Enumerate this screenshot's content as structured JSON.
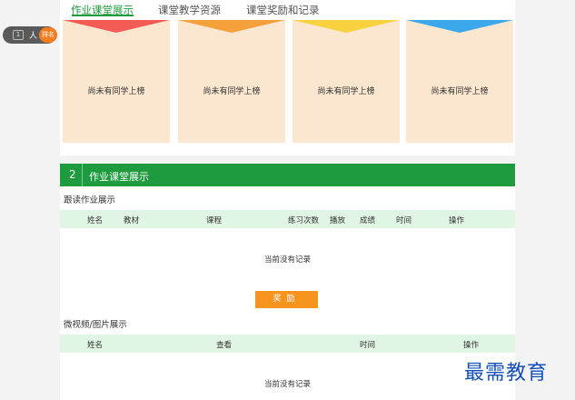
{
  "tabs": [
    {
      "label": "作业课堂展示",
      "active": true
    },
    {
      "label": "课堂教学资源",
      "active": false
    },
    {
      "label": "课堂奖励和记录",
      "active": false
    }
  ],
  "counter": {
    "value": "1",
    "unit": "人",
    "rank_label": "排名"
  },
  "ranking": {
    "cards": [
      {
        "empty_text": "尚未有同学上榜",
        "color": "#f25c54"
      },
      {
        "empty_text": "尚未有同学上榜",
        "color": "#f6a03c"
      },
      {
        "empty_text": "尚未有同学上榜",
        "color": "#f7d23e"
      },
      {
        "empty_text": "尚未有同学上榜",
        "color": "#3aa8ea"
      }
    ]
  },
  "section": {
    "number": "2",
    "title": "作业课堂展示",
    "reading": {
      "title": "跟读作业展示",
      "columns": [
        "姓名",
        "教材",
        "课程",
        "练习次数",
        "播放",
        "成绩",
        "时间",
        "操作"
      ],
      "empty_text": "当前没有记录"
    },
    "reward_button": "奖励",
    "video": {
      "title": "微视频/图片展示",
      "columns": [
        "姓名",
        "查看",
        "时间",
        "操作"
      ],
      "empty_text": "当前没有记录"
    }
  },
  "watermark": "最需教育",
  "colors": {
    "accent": "#1e9b3e",
    "header_row": "#e0f5e3",
    "card": "#fbe6cf",
    "button": "#f7941d"
  }
}
